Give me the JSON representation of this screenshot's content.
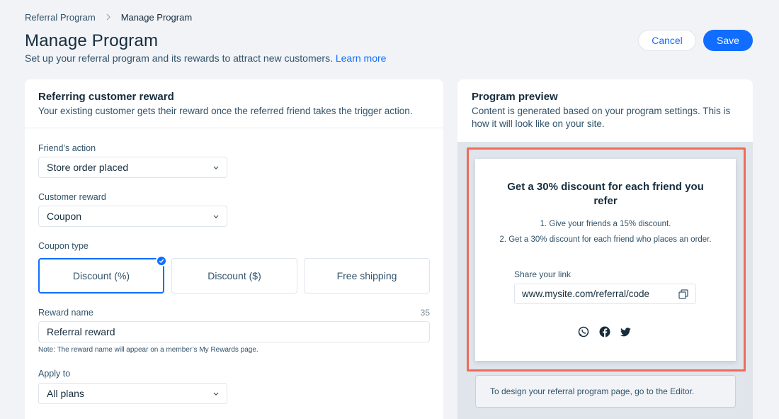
{
  "breadcrumb": {
    "parent": "Referral Program",
    "current": "Manage Program"
  },
  "header": {
    "title": "Manage Program",
    "subtitle": "Set up your referral program and its rewards to attract new customers.",
    "learn_more": "Learn more",
    "cancel_label": "Cancel",
    "save_label": "Save"
  },
  "left_card": {
    "title": "Referring customer reward",
    "description": "Your existing customer gets their reward once the referred friend takes the trigger action.",
    "friends_action": {
      "label": "Friend’s action",
      "value": "Store order placed"
    },
    "customer_reward": {
      "label": "Customer reward",
      "value": "Coupon"
    },
    "coupon_type": {
      "label": "Coupon type",
      "options": [
        "Discount (%)",
        "Discount ($)",
        "Free shipping"
      ],
      "selected": "Discount (%)"
    },
    "reward_name": {
      "label": "Reward name",
      "value": "Referral reward",
      "char_count": "35",
      "note": "Note: The reward name will appear on a member’s My Rewards page."
    },
    "apply_to": {
      "label": "Apply to",
      "value": "All plans"
    }
  },
  "right_card": {
    "title": "Program preview",
    "description": "Content is generated based on your program settings. This is how it will look like on your site.",
    "preview": {
      "headline": "Get a 30% discount for each friend you refer",
      "step1": "1. Give your friends a 15% discount.",
      "step2": "2. Get a 30% discount for each friend who places an order.",
      "share_label": "Share your link",
      "link": "www.mysite.com/referral/code",
      "social_icons": [
        "whatsapp-icon",
        "facebook-icon",
        "twitter-icon"
      ]
    },
    "editor_note": "To design your referral program page, go to the Editor."
  },
  "colors": {
    "accent": "#116dff",
    "highlight": "#f06a5a",
    "background": "#f1f3f7"
  }
}
